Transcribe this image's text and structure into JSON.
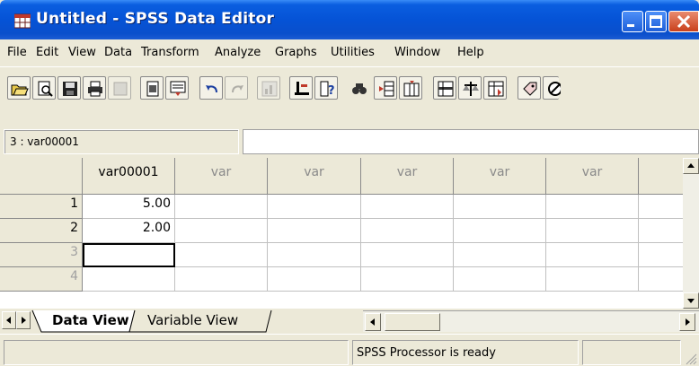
{
  "window": {
    "title": "Untitled - SPSS Data Editor",
    "app_icon": "spss-grid-icon",
    "controls": [
      "minimize-icon",
      "maximize-icon",
      "close-icon"
    ]
  },
  "menu": {
    "items": [
      "File",
      "Edit",
      "View",
      "Data",
      "Transform",
      "Analyze",
      "Graphs",
      "Utilities",
      "Window",
      "Help"
    ]
  },
  "toolbar": {
    "icons": [
      "open-file-icon",
      "print-preview-icon",
      "save-icon",
      "print-icon",
      "dialog-recall-icon",
      "undo-dialog-icon",
      "goto-case-icon",
      "undo-icon",
      "redo-icon",
      "goto-chart-icon",
      "goto-case-bar-icon",
      "variables-icon",
      "find-icon",
      "insert-cases-icon",
      "insert-variable-icon",
      "split-file-icon",
      "weight-cases-icon",
      "select-cases-icon",
      "value-labels-icon",
      "use-sets-icon"
    ]
  },
  "cell_editor": {
    "reference": "3 : var00001",
    "value": ""
  },
  "grid": {
    "columns": [
      "var00001",
      "var",
      "var",
      "var",
      "var",
      "var",
      "v"
    ],
    "rows": [
      {
        "num": "1",
        "values": [
          "5.00",
          "",
          "",
          "",
          "",
          "",
          ""
        ]
      },
      {
        "num": "2",
        "values": [
          "2.00",
          "",
          "",
          "",
          "",
          "",
          ""
        ]
      },
      {
        "num": "3",
        "values": [
          "",
          "",
          "",
          "",
          "",
          "",
          ""
        ]
      },
      {
        "num": "4",
        "values": [
          "",
          "",
          "",
          "",
          "",
          "",
          ""
        ]
      }
    ]
  },
  "tabs": {
    "data_view": "Data View",
    "variable_view": "Variable View"
  },
  "status": {
    "processor": "SPSS Processor  is ready",
    "info": ""
  },
  "colors": {
    "title_bar": "#0553d6",
    "title_text": "#ffffff",
    "chrome": "#ece9d8",
    "grid_line": "#c0c0c0"
  }
}
